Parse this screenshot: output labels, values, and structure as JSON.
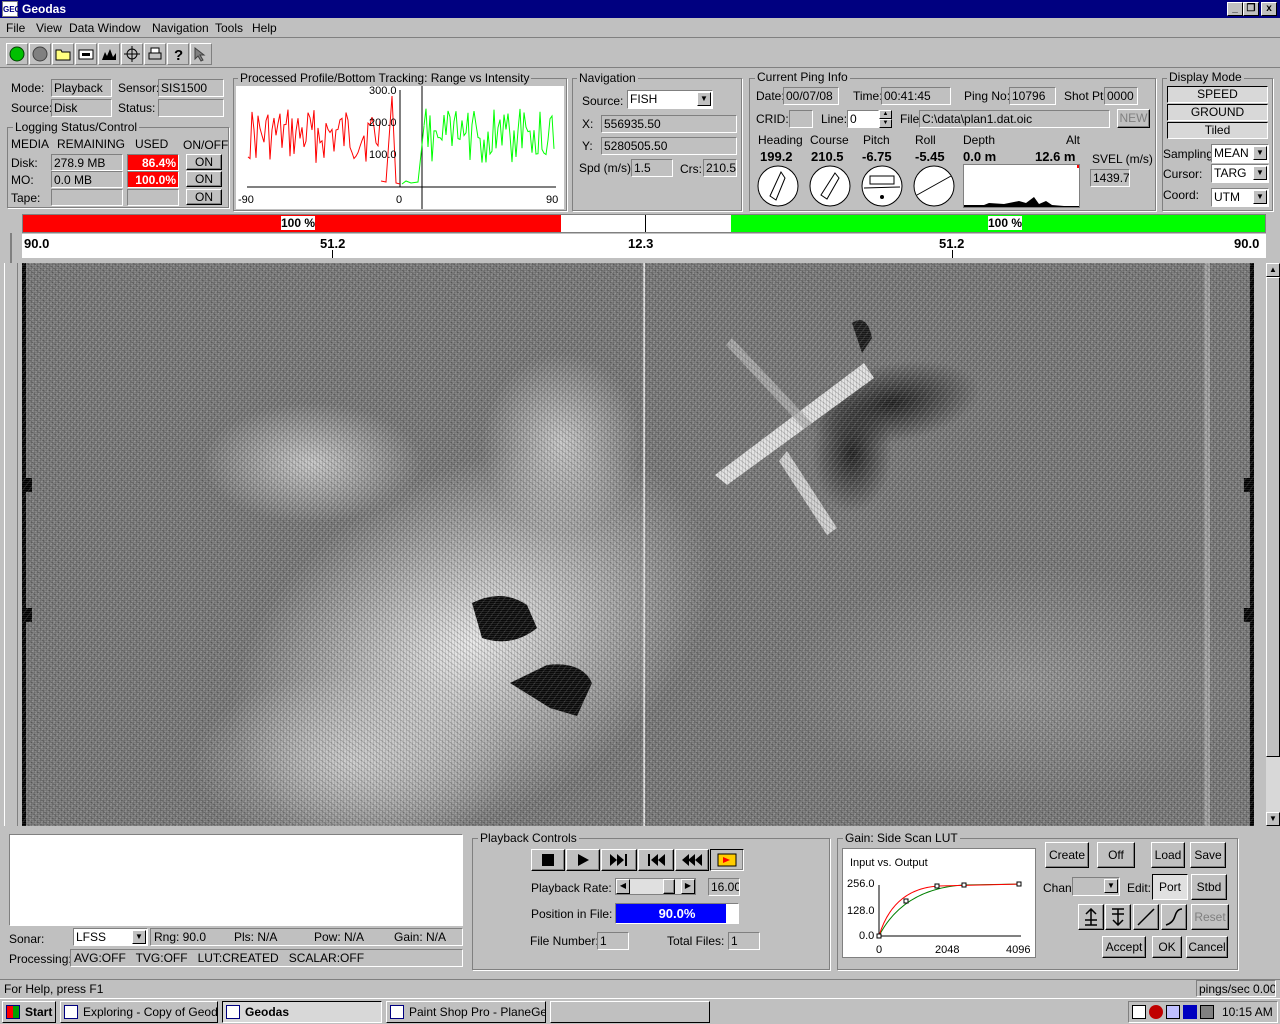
{
  "window": {
    "title": "Geodas",
    "icon": "GEO",
    "min": "_",
    "restore": "❐",
    "close": "x"
  },
  "menu": [
    "File",
    "View",
    "Data Window",
    "Navigation",
    "Tools",
    "Help"
  ],
  "toolbar": {
    "icons": [
      "green-circle-icon",
      "gray-circle-icon",
      "open-folder-icon",
      "tape-icon",
      "profile-icon",
      "crosshair-icon",
      "printer-icon",
      "help-icon",
      "cursor-help-icon"
    ]
  },
  "mode": {
    "mode_label": "Mode:",
    "mode_value": "Playback",
    "sensor_label": "Sensor:",
    "sensor_value": "SIS1500",
    "source_label": "Source:",
    "source_value": "Disk",
    "status_label": "Status:",
    "status_value": ""
  },
  "logging": {
    "title": "Logging Status/Control",
    "col_media": "MEDIA",
    "col_remaining": "REMAINING",
    "col_used": "USED",
    "col_onoff": "ON/OFF",
    "rows": [
      {
        "media": "Disk:",
        "remaining": "278.9 MB",
        "used": "86.4%",
        "onoff": "ON"
      },
      {
        "media": "MO:",
        "remaining": "0.0 MB",
        "used": "100.0%",
        "onoff": "ON"
      },
      {
        "media": "Tape:",
        "remaining": "",
        "used": "",
        "onoff": "ON"
      }
    ]
  },
  "profile": {
    "title": "Processed Profile/Bottom Tracking: Range vs Intensity",
    "y_ticks": [
      "300.0",
      "200.0",
      "100.0"
    ],
    "x_ticks": [
      "-90",
      "0",
      "90"
    ],
    "port_color": "#ff0000",
    "stbd_color": "#00ff00"
  },
  "navigation": {
    "title": "Navigation",
    "source_label": "Source:",
    "source_value": "FISH",
    "x_label": "X:",
    "x_value": "556935.50",
    "y_label": "Y:",
    "y_value": "5280505.50",
    "spd_label": "Spd (m/s):",
    "spd_value": "1.5",
    "crs_label": "Crs:",
    "crs_value": "210.5"
  },
  "ping": {
    "title": "Current Ping Info",
    "date_label": "Date:",
    "date_value": "00/07/08",
    "time_label": "Time:",
    "time_value": "00:41:45",
    "pingno_label": "Ping No:",
    "pingno_value": "10796",
    "shot_label": "Shot Pt:",
    "shot_value": "0000",
    "crid_label": "CRID:",
    "crid_value": "",
    "line_label": "Line:",
    "line_value": "0",
    "file_label": "File:",
    "file_value": "C:\\data\\plan1.dat.oic",
    "new_label": "NEW",
    "heading_label": "Heading",
    "heading_value": "199.2",
    "course_label": "Course",
    "course_value": "210.5",
    "pitch_label": "Pitch",
    "pitch_value": "-6.75",
    "roll_label": "Roll",
    "roll_value": "-5.45",
    "depth_label": "Depth",
    "depth_value": "0.0 m",
    "alt_label": "Alt",
    "alt_value": "12.6 m",
    "svel_label": "SVEL (m/s)",
    "svel_value": "1439.7"
  },
  "display_mode": {
    "title": "Display Mode",
    "buttons": [
      "SPEED CORRECT",
      "GROUND RANGE",
      "Tiled"
    ],
    "sampling_label": "Sampling:",
    "sampling_value": "MEAN",
    "cursor_label": "Cursor:",
    "cursor_value": "TARG",
    "coord_label": "Coord:",
    "coord_value": "UTM"
  },
  "gainbar": {
    "left_pct": "100 %",
    "right_pct": "100 %",
    "left_color": "#ff0000",
    "right_color": "#00ff00"
  },
  "range_scale": [
    "90.0",
    "51.2",
    "12.3",
    "51.2",
    "90.0"
  ],
  "sonar_labels": {
    "port": "",
    "stbd": ""
  },
  "info": {
    "sonar_label": "Sonar:",
    "sonar_value": "LFSS",
    "rng": "Rng: 90.0",
    "pls": "Pls: N/A",
    "pow": "Pow: N/A",
    "gain": "Gain: N/A",
    "processing_label": "Processing:",
    "processing_value": "AVG:OFF   TVG:OFF   LUT:CREATED   SCALAR:OFF"
  },
  "playback": {
    "title": "Playback Controls",
    "buttons": [
      "stop-icon",
      "play-icon",
      "fast-forward-icon",
      "skip-back-icon",
      "rewind-icon",
      "loop-icon"
    ],
    "rate_label": "Playback Rate:",
    "rate_value": "16.00",
    "position_label": "Position in File:",
    "position_value": "90.0%",
    "position_fraction": 0.9,
    "filenum_label": "File Number:",
    "filenum_value": "1",
    "total_label": "Total Files:",
    "total_value": "1"
  },
  "lut": {
    "title": "Gain: Side Scan LUT",
    "graph_title": "Input vs. Output",
    "y_ticks": [
      "256.0",
      "128.0",
      "0.0"
    ],
    "x_ticks": [
      "0",
      "2048",
      "4096"
    ],
    "create": "Create",
    "off": "Off",
    "load": "Load",
    "save": "Save",
    "chan_label": "Chan:",
    "edit_label": "Edit:",
    "port": "Port",
    "stbd": "Stbd",
    "reset": "Reset",
    "accept": "Accept",
    "ok": "OK",
    "cancel": "Cancel"
  },
  "status": {
    "help": "For Help, press F1",
    "rate": "pings/sec 0.00"
  },
  "taskbar": {
    "start": "Start",
    "tasks": [
      "Exploring - Copy of Geoda...",
      "Geodas",
      "Paint Shop Pro - PlaneGeo...",
      ""
    ],
    "clock": "10:15 AM"
  }
}
